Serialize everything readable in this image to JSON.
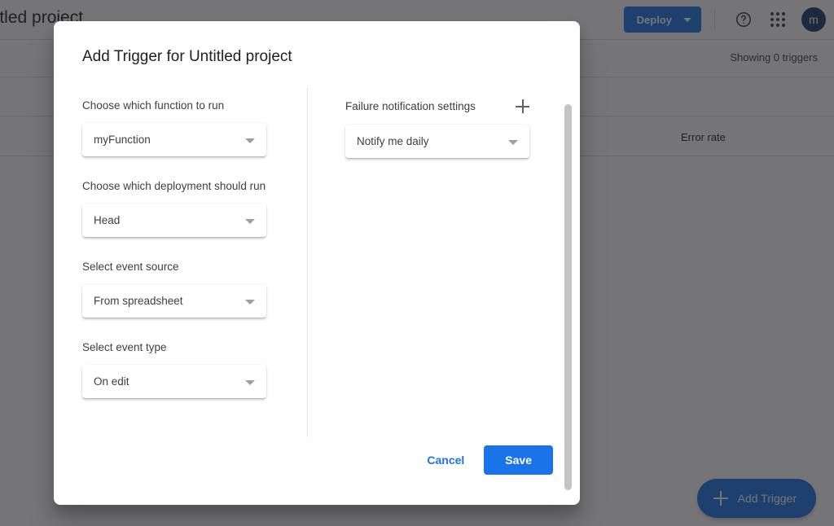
{
  "background": {
    "project_title": "Untitled project",
    "deploy_button": "Deploy",
    "help_icon": "help-circle-icon",
    "apps_icon": "apps-grid-icon",
    "avatar_initial": "m",
    "showing_text": "Showing 0 triggers",
    "table_columns": [
      "Error rate"
    ],
    "fab_label": "Add Trigger"
  },
  "dialog": {
    "title": "Add Trigger for Untitled project",
    "left_fields": [
      {
        "label": "Choose which function to run",
        "value": "myFunction"
      },
      {
        "label": "Choose which deployment should run",
        "value": "Head"
      },
      {
        "label": "Select event source",
        "value": "From spreadsheet"
      },
      {
        "label": "Select event type",
        "value": "On edit"
      }
    ],
    "right": {
      "label": "Failure notification settings",
      "add_icon": "plus-icon",
      "value": "Notify me daily"
    },
    "cancel_label": "Cancel",
    "save_label": "Save"
  },
  "colors": {
    "accent_blue": "#1a73e8",
    "scrim": "#202124",
    "text_primary": "#202124",
    "text_secondary": "#3c4043"
  }
}
